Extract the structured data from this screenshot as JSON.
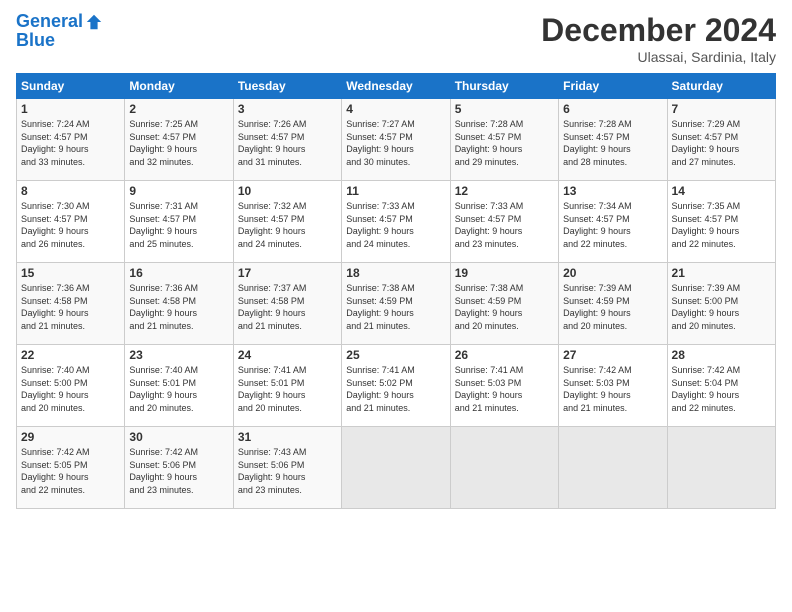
{
  "header": {
    "logo_line1": "General",
    "logo_line2": "Blue",
    "month": "December 2024",
    "location": "Ulassai, Sardinia, Italy"
  },
  "weekdays": [
    "Sunday",
    "Monday",
    "Tuesday",
    "Wednesday",
    "Thursday",
    "Friday",
    "Saturday"
  ],
  "weeks": [
    [
      {
        "day": "1",
        "info": "Sunrise: 7:24 AM\nSunset: 4:57 PM\nDaylight: 9 hours\nand 33 minutes."
      },
      {
        "day": "2",
        "info": "Sunrise: 7:25 AM\nSunset: 4:57 PM\nDaylight: 9 hours\nand 32 minutes."
      },
      {
        "day": "3",
        "info": "Sunrise: 7:26 AM\nSunset: 4:57 PM\nDaylight: 9 hours\nand 31 minutes."
      },
      {
        "day": "4",
        "info": "Sunrise: 7:27 AM\nSunset: 4:57 PM\nDaylight: 9 hours\nand 30 minutes."
      },
      {
        "day": "5",
        "info": "Sunrise: 7:28 AM\nSunset: 4:57 PM\nDaylight: 9 hours\nand 29 minutes."
      },
      {
        "day": "6",
        "info": "Sunrise: 7:28 AM\nSunset: 4:57 PM\nDaylight: 9 hours\nand 28 minutes."
      },
      {
        "day": "7",
        "info": "Sunrise: 7:29 AM\nSunset: 4:57 PM\nDaylight: 9 hours\nand 27 minutes."
      }
    ],
    [
      {
        "day": "8",
        "info": "Sunrise: 7:30 AM\nSunset: 4:57 PM\nDaylight: 9 hours\nand 26 minutes."
      },
      {
        "day": "9",
        "info": "Sunrise: 7:31 AM\nSunset: 4:57 PM\nDaylight: 9 hours\nand 25 minutes."
      },
      {
        "day": "10",
        "info": "Sunrise: 7:32 AM\nSunset: 4:57 PM\nDaylight: 9 hours\nand 24 minutes."
      },
      {
        "day": "11",
        "info": "Sunrise: 7:33 AM\nSunset: 4:57 PM\nDaylight: 9 hours\nand 24 minutes."
      },
      {
        "day": "12",
        "info": "Sunrise: 7:33 AM\nSunset: 4:57 PM\nDaylight: 9 hours\nand 23 minutes."
      },
      {
        "day": "13",
        "info": "Sunrise: 7:34 AM\nSunset: 4:57 PM\nDaylight: 9 hours\nand 22 minutes."
      },
      {
        "day": "14",
        "info": "Sunrise: 7:35 AM\nSunset: 4:57 PM\nDaylight: 9 hours\nand 22 minutes."
      }
    ],
    [
      {
        "day": "15",
        "info": "Sunrise: 7:36 AM\nSunset: 4:58 PM\nDaylight: 9 hours\nand 21 minutes."
      },
      {
        "day": "16",
        "info": "Sunrise: 7:36 AM\nSunset: 4:58 PM\nDaylight: 9 hours\nand 21 minutes."
      },
      {
        "day": "17",
        "info": "Sunrise: 7:37 AM\nSunset: 4:58 PM\nDaylight: 9 hours\nand 21 minutes."
      },
      {
        "day": "18",
        "info": "Sunrise: 7:38 AM\nSunset: 4:59 PM\nDaylight: 9 hours\nand 21 minutes."
      },
      {
        "day": "19",
        "info": "Sunrise: 7:38 AM\nSunset: 4:59 PM\nDaylight: 9 hours\nand 20 minutes."
      },
      {
        "day": "20",
        "info": "Sunrise: 7:39 AM\nSunset: 4:59 PM\nDaylight: 9 hours\nand 20 minutes."
      },
      {
        "day": "21",
        "info": "Sunrise: 7:39 AM\nSunset: 5:00 PM\nDaylight: 9 hours\nand 20 minutes."
      }
    ],
    [
      {
        "day": "22",
        "info": "Sunrise: 7:40 AM\nSunset: 5:00 PM\nDaylight: 9 hours\nand 20 minutes."
      },
      {
        "day": "23",
        "info": "Sunrise: 7:40 AM\nSunset: 5:01 PM\nDaylight: 9 hours\nand 20 minutes."
      },
      {
        "day": "24",
        "info": "Sunrise: 7:41 AM\nSunset: 5:01 PM\nDaylight: 9 hours\nand 20 minutes."
      },
      {
        "day": "25",
        "info": "Sunrise: 7:41 AM\nSunset: 5:02 PM\nDaylight: 9 hours\nand 21 minutes."
      },
      {
        "day": "26",
        "info": "Sunrise: 7:41 AM\nSunset: 5:03 PM\nDaylight: 9 hours\nand 21 minutes."
      },
      {
        "day": "27",
        "info": "Sunrise: 7:42 AM\nSunset: 5:03 PM\nDaylight: 9 hours\nand 21 minutes."
      },
      {
        "day": "28",
        "info": "Sunrise: 7:42 AM\nSunset: 5:04 PM\nDaylight: 9 hours\nand 22 minutes."
      }
    ],
    [
      {
        "day": "29",
        "info": "Sunrise: 7:42 AM\nSunset: 5:05 PM\nDaylight: 9 hours\nand 22 minutes."
      },
      {
        "day": "30",
        "info": "Sunrise: 7:42 AM\nSunset: 5:06 PM\nDaylight: 9 hours\nand 23 minutes."
      },
      {
        "day": "31",
        "info": "Sunrise: 7:43 AM\nSunset: 5:06 PM\nDaylight: 9 hours\nand 23 minutes."
      },
      {
        "day": "",
        "info": ""
      },
      {
        "day": "",
        "info": ""
      },
      {
        "day": "",
        "info": ""
      },
      {
        "day": "",
        "info": ""
      }
    ]
  ]
}
